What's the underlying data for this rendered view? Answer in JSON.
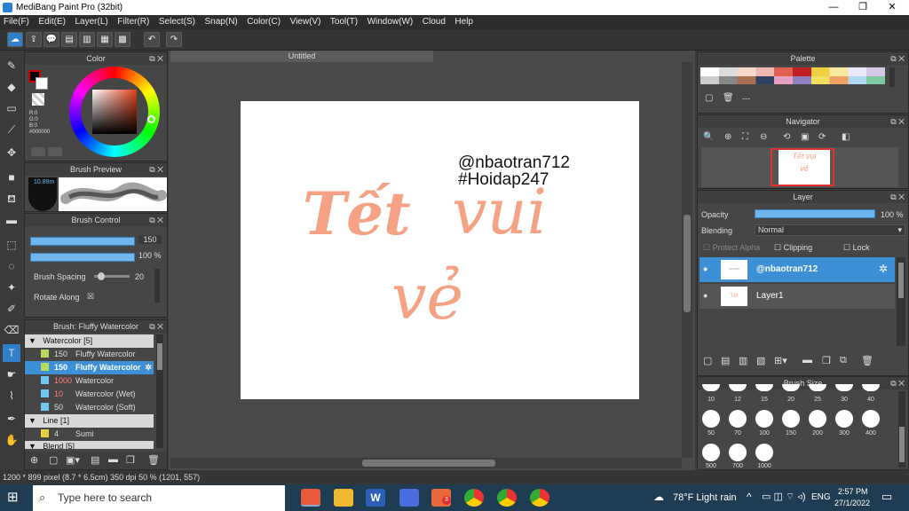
{
  "window": {
    "title": "MediBang Paint Pro (32bit)",
    "minimize": "—",
    "maximize": "❐",
    "close": "✕"
  },
  "menu": [
    "File(F)",
    "Edit(E)",
    "Layer(L)",
    "Filter(R)",
    "Select(S)",
    "Snap(N)",
    "Color(C)",
    "View(V)",
    "Tool(T)",
    "Window(W)",
    "Cloud",
    "Help"
  ],
  "color_panel": {
    "title": "Color",
    "r": "R:0",
    "g": "G:0",
    "b": "B:0",
    "hex": "#000000"
  },
  "brush_preview": {
    "title": "Brush Preview",
    "size": "10.89m"
  },
  "brush_control": {
    "title": "Brush Control",
    "size_value": "150",
    "opacity_value": "100 %",
    "spacing_label": "Brush Spacing",
    "spacing_value": "20",
    "rotate_label": "Rotate Along",
    "rotate_check": "☒"
  },
  "brush_list": {
    "title": "Brush: Fluffy Watercolor",
    "groups": [
      {
        "label": "Watercolor [5]"
      },
      {
        "label": "Line [1]"
      },
      {
        "label": "Blend [5]"
      }
    ],
    "items": [
      {
        "size": "150",
        "name": "Fluffy Watercolor",
        "color": "#b8d95a"
      },
      {
        "size": "150",
        "name": "Fluffy Watercolor",
        "color": "#b8d95a"
      },
      {
        "size": "1000",
        "name": "Watercolor",
        "color": "#6fc8f0"
      },
      {
        "size": "10",
        "name": "Watercolor (Wet)",
        "color": "#6fc8f0"
      },
      {
        "size": "50",
        "name": "Watercolor (Soft)",
        "color": "#6fc8f0"
      },
      {
        "size": "4",
        "name": "Sumi",
        "color": "#e8d040"
      }
    ]
  },
  "document": {
    "tab": "Untitled",
    "text_line1": "@nbaotran712",
    "text_line2": "#Hoidap247",
    "script_word1": "Tết",
    "script_word2": "vui",
    "script_word3": "vẻ",
    "script_color": "#f4a184"
  },
  "palette": {
    "title": "Palette",
    "sep": "---"
  },
  "navigator": {
    "title": "Navigator"
  },
  "layer_panel": {
    "title": "Layer",
    "opacity_label": "Opacity",
    "opacity_value": "100 %",
    "blending_label": "Blending",
    "blending_value": "Normal",
    "protect_alpha": "Protect Alpha",
    "clipping": "Clipping",
    "lock": "Lock",
    "layers": [
      {
        "name": "@nbaotran712"
      },
      {
        "name": "Layer1"
      }
    ]
  },
  "brush_size": {
    "title": "Brush Size",
    "sizes": [
      "10",
      "12",
      "15",
      "20",
      "25",
      "30",
      "40",
      "50",
      "70",
      "100",
      "150",
      "200",
      "300",
      "400",
      "500",
      "700",
      "1000"
    ]
  },
  "status": "1200 * 899 pixel  (8.7 * 6.5cm)  350 dpi  50 %  (1201, 557)",
  "taskbar": {
    "search_placeholder": "Type here to search",
    "weather": "78°F  Light rain",
    "lang": "ENG",
    "time": "2:57 PM",
    "date": "27/1/2022",
    "badge": "3"
  }
}
